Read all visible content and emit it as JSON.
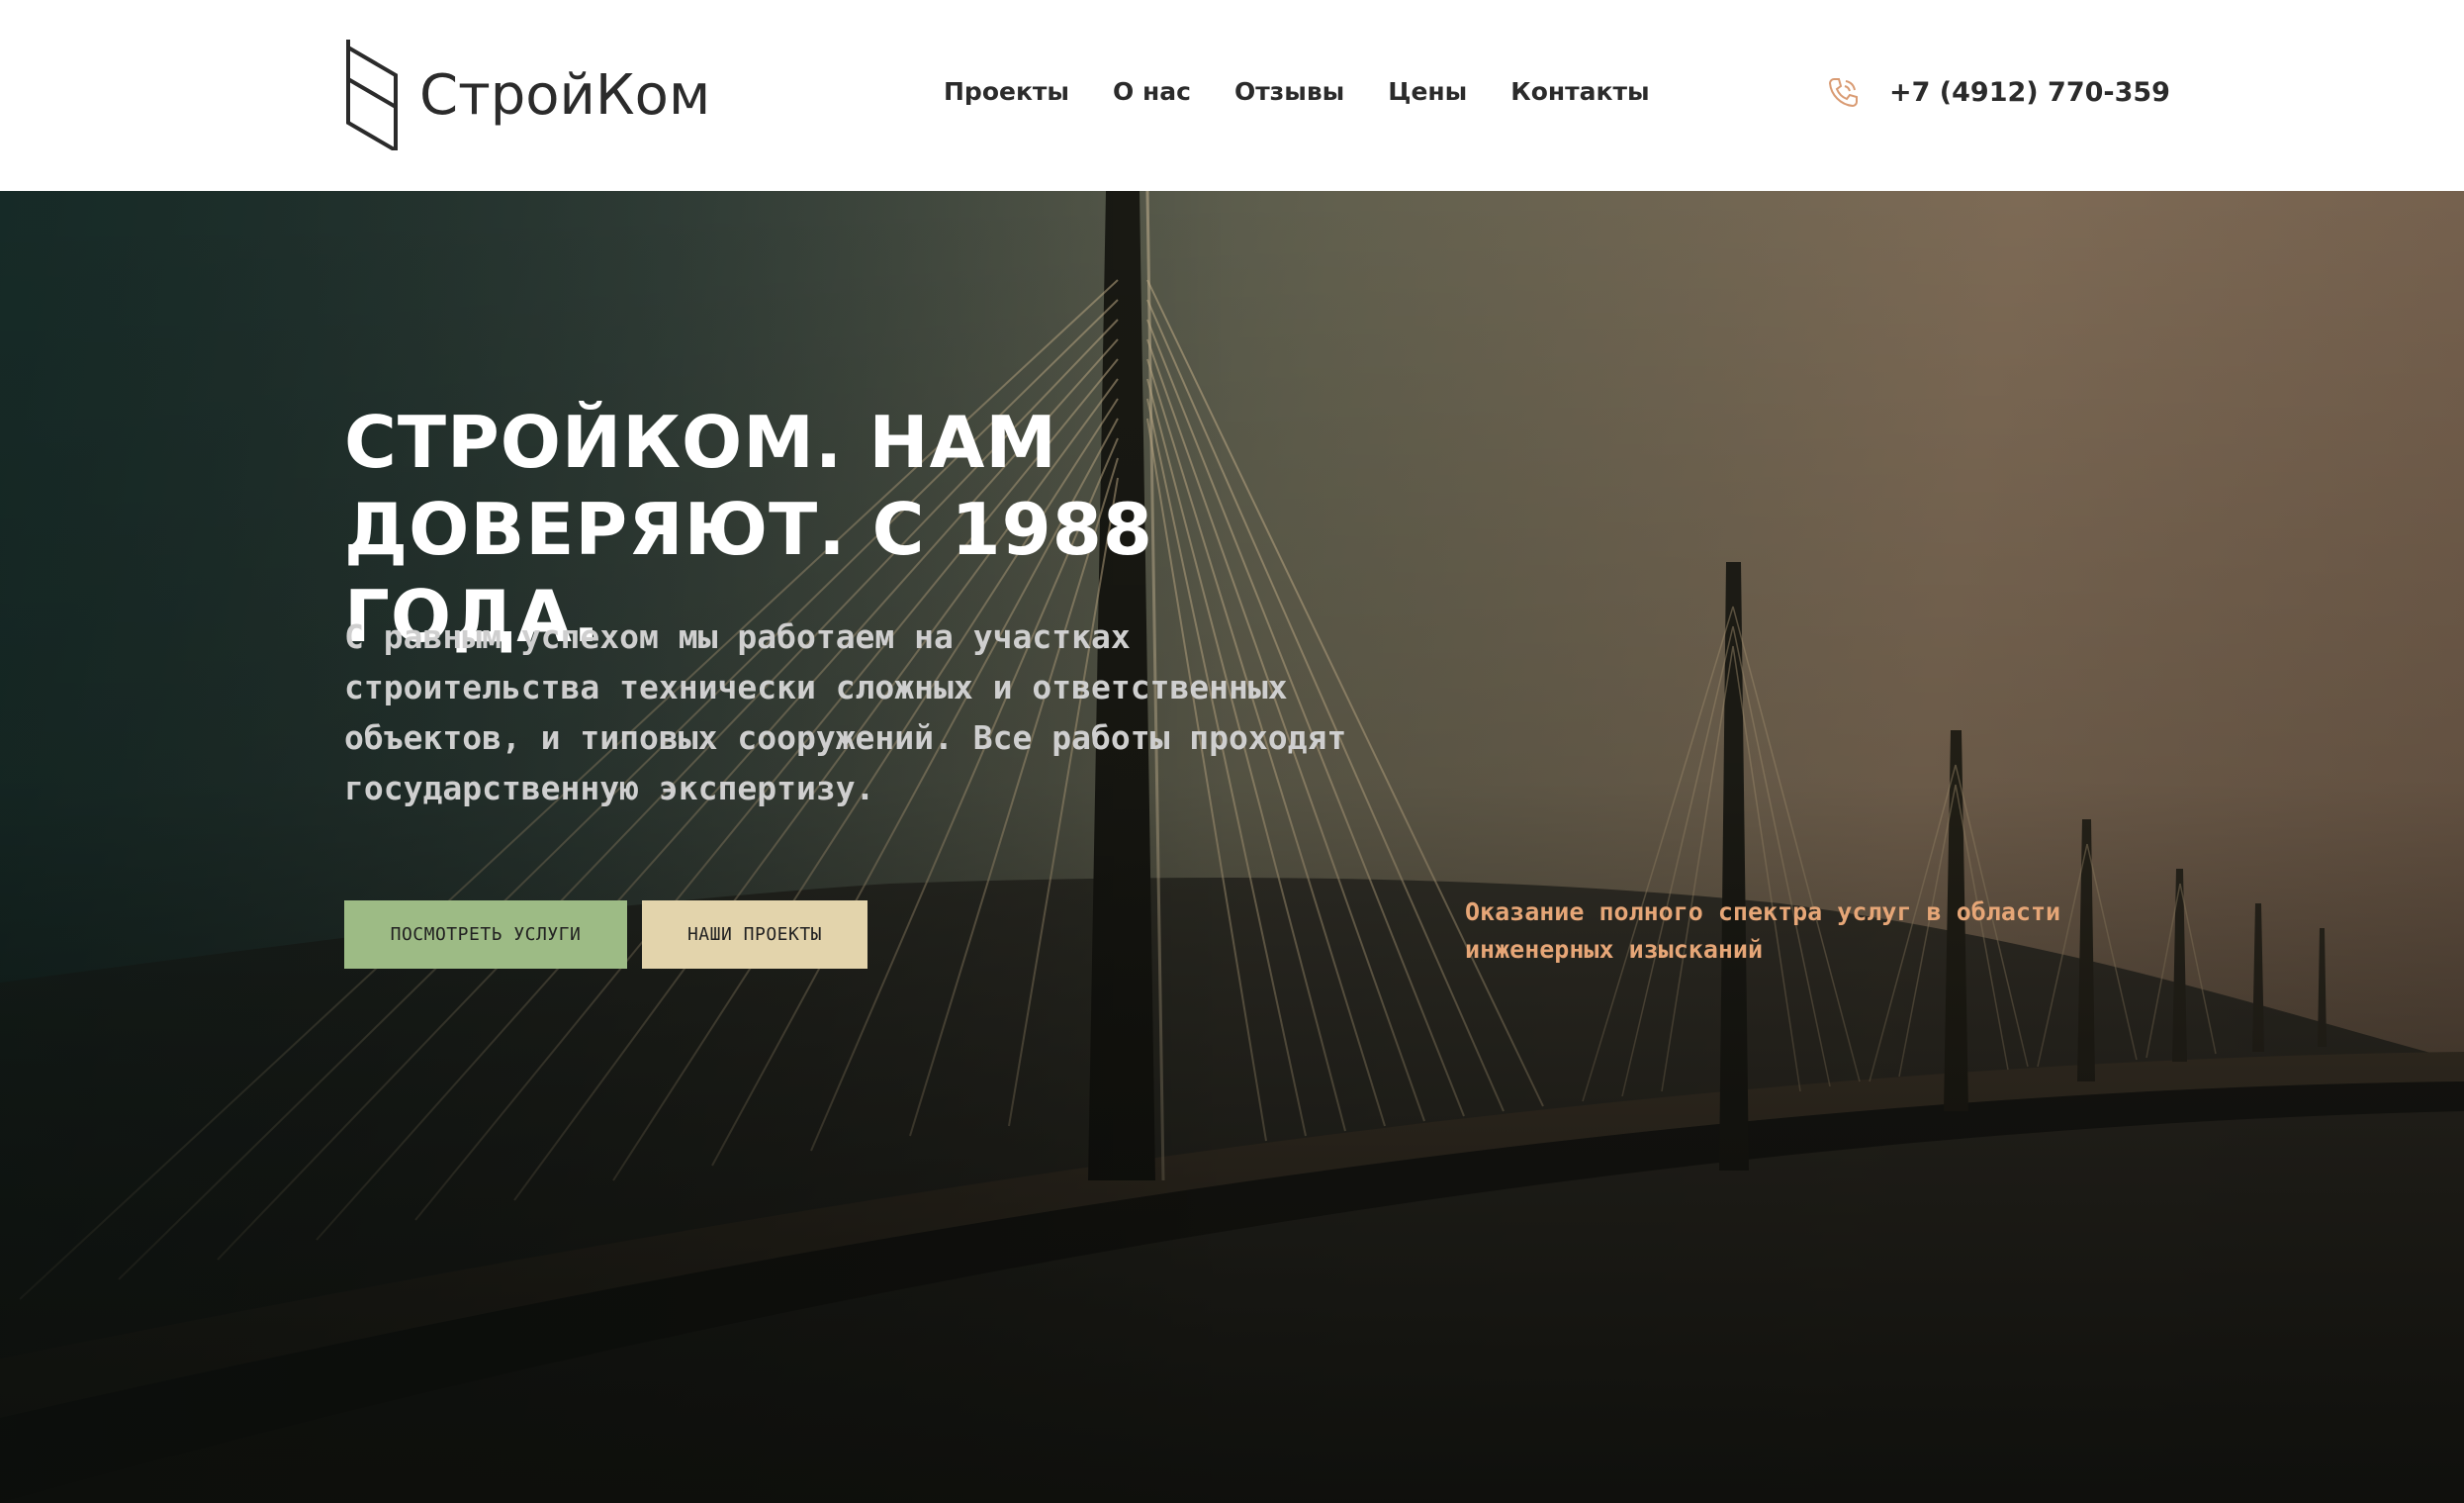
{
  "header": {
    "logo_text": "СтройКом",
    "nav": [
      {
        "label": "Проекты"
      },
      {
        "label": "О нас"
      },
      {
        "label": "Отзывы"
      },
      {
        "label": "Цены"
      },
      {
        "label": "Контакты"
      }
    ],
    "phone": "+7 (4912) 770-359",
    "phone_icon": "phone-icon"
  },
  "hero": {
    "title": "СТРОЙКОМ. НАМ ДОВЕРЯЮТ. С 1988 ГОДА.",
    "description": "С равным успехом мы работаем на участках строительства технически сложных и ответственных объектов, и типовых сооружений. Все работы проходят государственную экспертизу.",
    "buttons": {
      "services": "ПОСМОТРЕТЬ УСЛУГИ",
      "projects": "НАШИ ПРОЕКТЫ"
    },
    "note": "Оказание полного спектра услуг в области инженерных изысканий"
  },
  "colors": {
    "accent_green": "#9dbb85",
    "accent_sand": "#e3d4ac",
    "note_orange": "#e6a677",
    "text_dark": "#2b2b2b"
  }
}
